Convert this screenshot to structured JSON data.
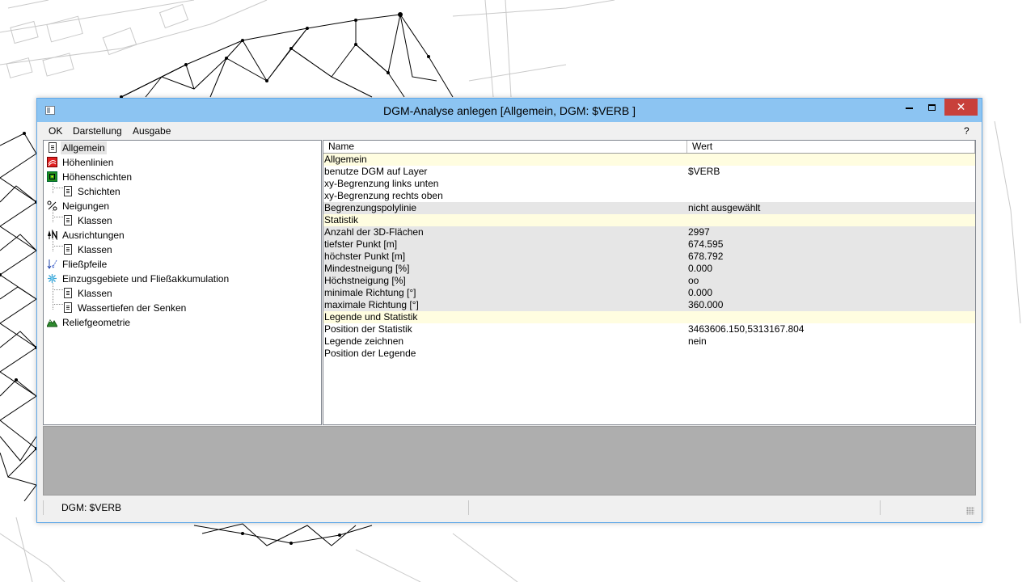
{
  "window": {
    "title": "DGM-Analyse anlegen [Allgemein, DGM: $VERB ]",
    "close_label": "✕"
  },
  "menu": {
    "ok": "OK",
    "darstellung": "Darstellung",
    "ausgabe": "Ausgabe",
    "help": "?"
  },
  "tree": {
    "items": [
      {
        "label": "Allgemein",
        "icon": "document-icon",
        "selected": true
      },
      {
        "label": "Höhenlinien",
        "icon": "contour-lines-icon"
      },
      {
        "label": "Höhenschichten",
        "icon": "elevation-layers-icon"
      },
      {
        "label": "Schichten",
        "icon": "document-icon"
      },
      {
        "label": "Neigungen",
        "icon": "slope-icon"
      },
      {
        "label": "Klassen",
        "icon": "document-icon"
      },
      {
        "label": "Ausrichtungen",
        "icon": "north-arrow-icon"
      },
      {
        "label": "Klassen",
        "icon": "document-icon"
      },
      {
        "label": "Fließpfeile",
        "icon": "flow-arrows-icon"
      },
      {
        "label": "Einzugsgebiete und Fließakkumulation",
        "icon": "catchment-icon"
      },
      {
        "label": "Klassen",
        "icon": "document-icon"
      },
      {
        "label": "Wassertiefen der Senken",
        "icon": "document-icon"
      },
      {
        "label": "Reliefgeometrie",
        "icon": "relief-icon"
      }
    ]
  },
  "grid": {
    "col_name": "Name",
    "col_value": "Wert",
    "rows": [
      {
        "name": "Allgemein",
        "value": "",
        "kind": "section"
      },
      {
        "name": "benutze DGM auf Layer",
        "value": "$VERB",
        "kind": "plain"
      },
      {
        "name": "xy-Begrenzung links unten",
        "value": "",
        "kind": "plain"
      },
      {
        "name": "xy-Begrenzung rechts oben",
        "value": "",
        "kind": "plain"
      },
      {
        "name": "Begrenzungspolylinie",
        "value": "nicht ausgewählt",
        "kind": "shaded"
      },
      {
        "name": "Statistik",
        "value": "",
        "kind": "section"
      },
      {
        "name": "Anzahl der 3D-Flächen",
        "value": "2997",
        "kind": "shaded"
      },
      {
        "name": "tiefster Punkt [m]",
        "value": "674.595",
        "kind": "shaded"
      },
      {
        "name": "höchster Punkt [m]",
        "value": "678.792",
        "kind": "shaded"
      },
      {
        "name": "Mindestneigung [%]",
        "value": "0.000",
        "kind": "shaded"
      },
      {
        "name": "Höchstneigung [%]",
        "value": "oo",
        "kind": "shaded"
      },
      {
        "name": "minimale Richtung [°]",
        "value": "0.000",
        "kind": "shaded"
      },
      {
        "name": "maximale Richtung [°]",
        "value": "360.000",
        "kind": "shaded"
      },
      {
        "name": "Legende und Statistik",
        "value": "",
        "kind": "section"
      },
      {
        "name": "Position der Statistik",
        "value": "3463606.150,5313167.804",
        "kind": "plain"
      },
      {
        "name": "Legende zeichnen",
        "value": "nein",
        "kind": "plain"
      },
      {
        "name": "Position der Legende",
        "value": "",
        "kind": "plain"
      }
    ]
  },
  "statusbar": {
    "text": "DGM: $VERB"
  },
  "colors": {
    "titlebar": "#8cc4f2",
    "close_button": "#c8403a",
    "section_row": "#fffde0",
    "shaded_row": "#e6e6e6",
    "preview": "#aeaeae"
  }
}
